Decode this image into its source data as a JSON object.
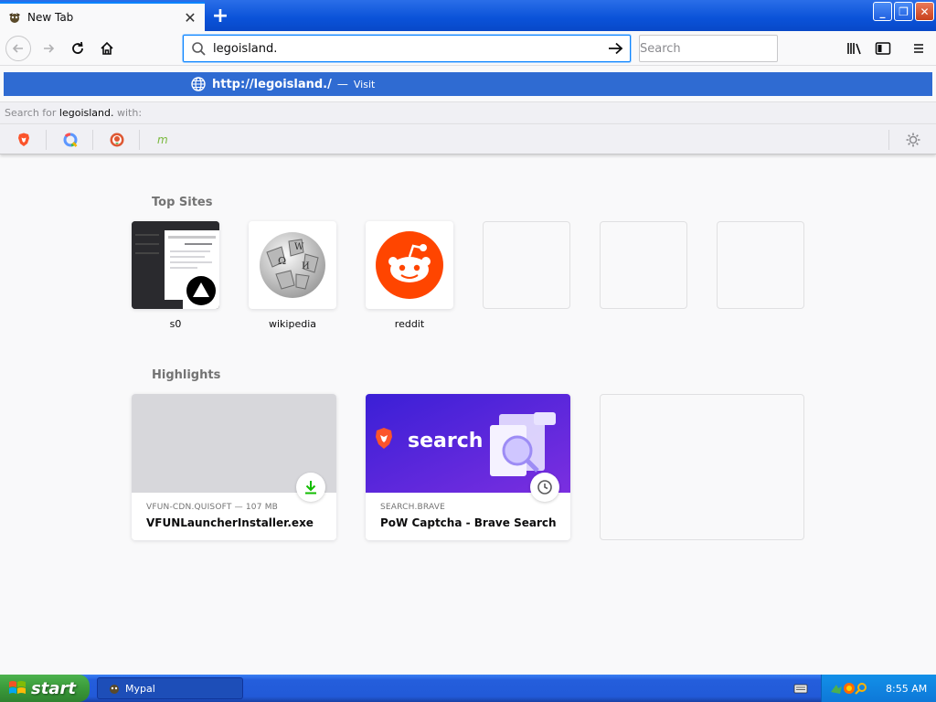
{
  "tab": {
    "title": "New Tab"
  },
  "urlbar": {
    "value": "legoisland."
  },
  "searchbar": {
    "placeholder": "Search"
  },
  "autocomplete": {
    "url": "http://legoisland./",
    "separator": "—",
    "action": "Visit"
  },
  "search_with": {
    "prefix": "Search for",
    "term": "legoisland.",
    "suffix": "with:"
  },
  "engines": [
    "brave-icon",
    "qwant-icon",
    "duckduckgo-icon",
    "mojeek-icon"
  ],
  "newtab": {
    "top_sites_title": "Top Sites",
    "top_sites": [
      {
        "label": "s0"
      },
      {
        "label": "wikipedia"
      },
      {
        "label": "reddit"
      },
      {
        "label": ""
      },
      {
        "label": ""
      },
      {
        "label": ""
      }
    ],
    "highlights_title": "Highlights",
    "highlights": [
      {
        "source": "VFUN-CDN.QUISOFT — 107 MB",
        "title": "VFUNLauncherInstaller.exe"
      },
      {
        "source": "SEARCH.BRAVE",
        "title": "PoW Captcha - Brave Search",
        "image_text": "search"
      }
    ]
  },
  "taskbar": {
    "start_label": "start",
    "task_label": "Mypal",
    "clock": "8:55 AM"
  },
  "colors": {
    "accent": "#0a84ff",
    "autocomplete_bg": "#2f6bd2",
    "reddit": "#ff4500",
    "brave_purple": "#5b2bd9"
  }
}
